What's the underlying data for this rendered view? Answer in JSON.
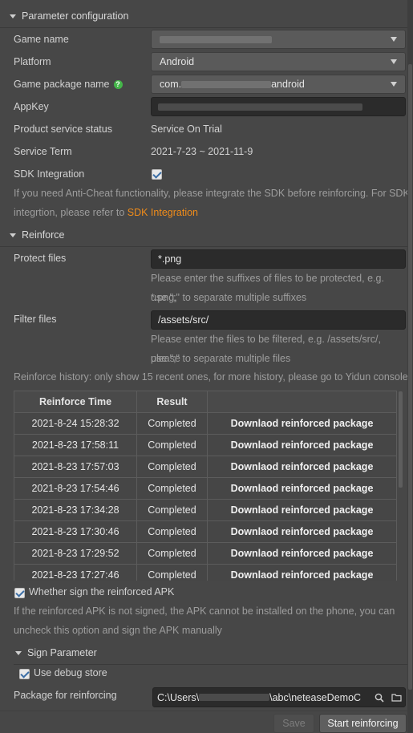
{
  "param_section": {
    "title": "Parameter configuration"
  },
  "game_name": {
    "label": "Game name"
  },
  "platform": {
    "label": "Platform",
    "value": "Android"
  },
  "package": {
    "label": "Game package name",
    "value_prefix": "com.",
    "value_suffix": "android"
  },
  "appkey": {
    "label": "AppKey"
  },
  "service_status": {
    "label": "Product service status",
    "value": "Service On Trial"
  },
  "service_term": {
    "label": "Service Term",
    "value": "2021-7-23 ~ 2021-11-9"
  },
  "sdk": {
    "label": "SDK Integration",
    "hint_line1": "If you need Anti-Cheat functionality, please integrate the SDK before reinforcing. For SDK",
    "hint_line2": "integrtion, please refer to ",
    "link": "SDK Integration",
    "link_color": "#f08c1a"
  },
  "reinforce_section": {
    "title": "Reinforce"
  },
  "protect_files": {
    "label": "Protect files",
    "value": "*.png",
    "hint1": "Please enter the suffixes of files to be protected, e.g. *.png,",
    "hint2": "use \";\" to separate multiple suffixes"
  },
  "filter_files": {
    "label": "Filter files",
    "value": "/assets/src/",
    "hint1": "Please enter the files to be filtered, e.g. /assets/src/, please",
    "hint2": "use \";\" to separate multiple files"
  },
  "history": {
    "note": "Reinforce history: only show 15 recent ones, for more history, please go to Yidun console",
    "headers": [
      "Reinforce Time",
      "Result",
      ""
    ],
    "rows": [
      [
        "2021-8-24 15:28:32",
        "Completed",
        "Downlaod reinforced package"
      ],
      [
        "2021-8-23 17:58:11",
        "Completed",
        "Downlaod reinforced package"
      ],
      [
        "2021-8-23 17:57:03",
        "Completed",
        "Downlaod reinforced package"
      ],
      [
        "2021-8-23 17:54:46",
        "Completed",
        "Downlaod reinforced package"
      ],
      [
        "2021-8-23 17:34:28",
        "Completed",
        "Downlaod reinforced package"
      ],
      [
        "2021-8-23 17:30:46",
        "Completed",
        "Downlaod reinforced package"
      ],
      [
        "2021-8-23 17:29:52",
        "Completed",
        "Downlaod reinforced package"
      ],
      [
        "2021-8-23 17:27:46",
        "Completed",
        "Downlaod reinforced package"
      ]
    ]
  },
  "sign_apk": {
    "label": "Whether sign the reinforced APK",
    "hint1": "If the reinforced APK is not signed, the APK cannot be installed on the phone, you can",
    "hint2": "uncheck this option and sign the APK manually"
  },
  "sign_section": {
    "title": "Sign Parameter"
  },
  "debug_store": {
    "label": "Use debug store"
  },
  "package_path": {
    "label": "Package for reinforcing",
    "prefix": "C:\\Users\\",
    "suffix": "\\abc\\neteaseDemoC"
  },
  "buttons": {
    "save": "Save",
    "start": "Start reinforcing"
  },
  "icons": {
    "link": "link-icon",
    "search": "search-icon",
    "folder": "folder-icon",
    "help": "help-icon"
  }
}
